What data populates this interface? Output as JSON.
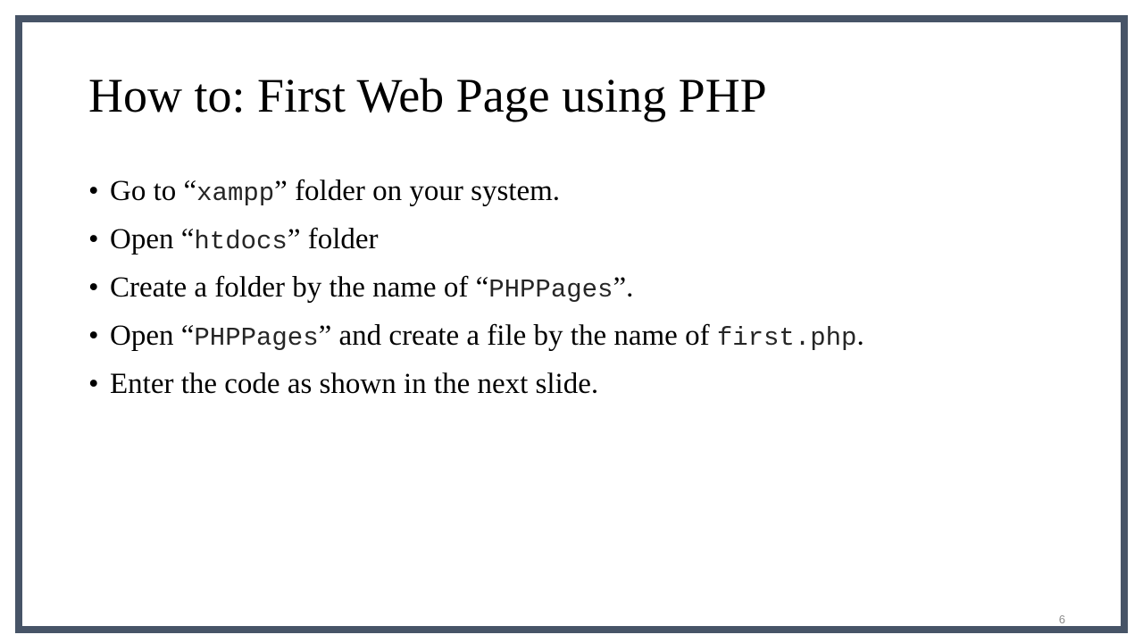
{
  "slide": {
    "title": "How to: First Web Page using PHP",
    "bullet_symbol": "•",
    "bullets": [
      {
        "parts": [
          "Go to “",
          "xampp",
          "” folder on your system."
        ]
      },
      {
        "parts": [
          "Open “",
          "htdocs",
          "” folder"
        ]
      },
      {
        "parts": [
          "Create a folder by the name of “",
          "PHPPages",
          "”."
        ]
      },
      {
        "parts": [
          "Open “",
          "PHPPages",
          "” and create a file by the name of ",
          "first.php",
          "."
        ]
      },
      {
        "parts": [
          "Enter the code as shown in the next slide."
        ]
      }
    ],
    "page_number": "6"
  },
  "colors": {
    "border": "#475467",
    "background": "#ffffff",
    "text": "#000000",
    "page_number": "#8c8c8c"
  }
}
